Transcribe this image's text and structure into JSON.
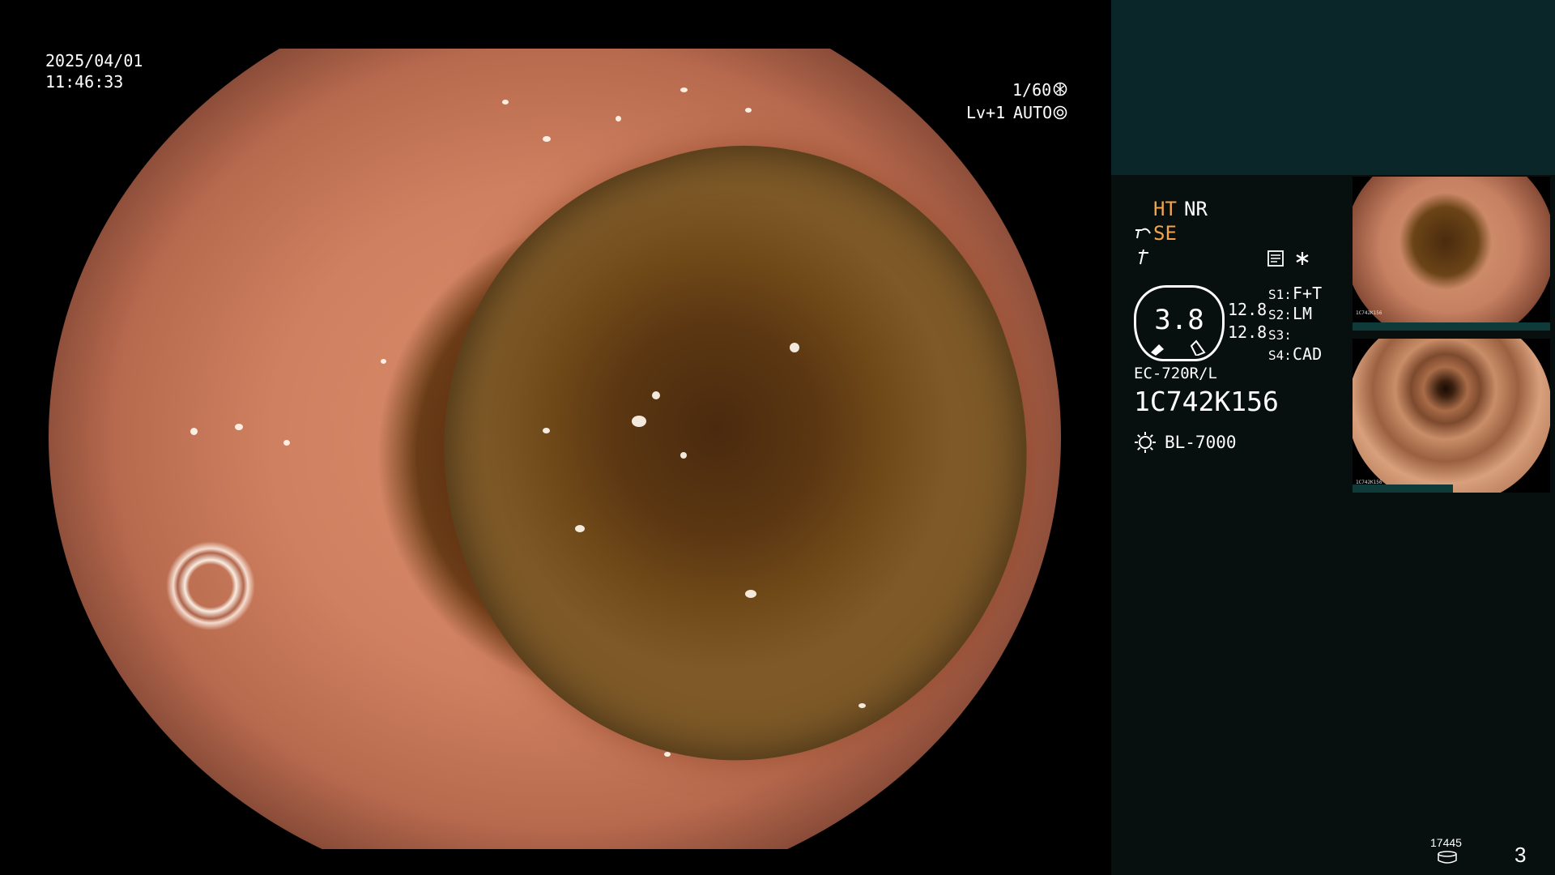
{
  "overlay": {
    "date": "2025/04/01",
    "time": "11:46:33",
    "shutter": "1/60",
    "level": "Lv+1",
    "exposure_mode": "AUTO"
  },
  "panel": {
    "hypertension": "HT",
    "noise_reduction": "NR",
    "structure_enhancement": "SE",
    "zoom": "3.8",
    "scale_top": "12.8",
    "scale_bottom": "12.8",
    "s1_label": "S1:",
    "s1_value": "F+T",
    "s2_label": "S2:",
    "s2_value": "LM",
    "s3_label": "S3:",
    "s3_value": "",
    "s4_label": "S4:",
    "s4_value": "CAD",
    "scope_model": "EC-720R/L",
    "serial": "1C742K156",
    "light_source": "BL-7000",
    "frame_counter": "17445",
    "image_count": "3"
  },
  "thumbnails": [
    {
      "label": "1C742K156"
    },
    {
      "label": "1C742K156"
    }
  ],
  "icons": {
    "shutter": "aperture-icon",
    "auto": "auto-iris-icon",
    "se": "structure-enhance-icon",
    "color": "color-mode-icon",
    "memo": "memo-icon",
    "star": "asterisk-icon",
    "light": "light-source-icon",
    "storage": "storage-icon"
  }
}
